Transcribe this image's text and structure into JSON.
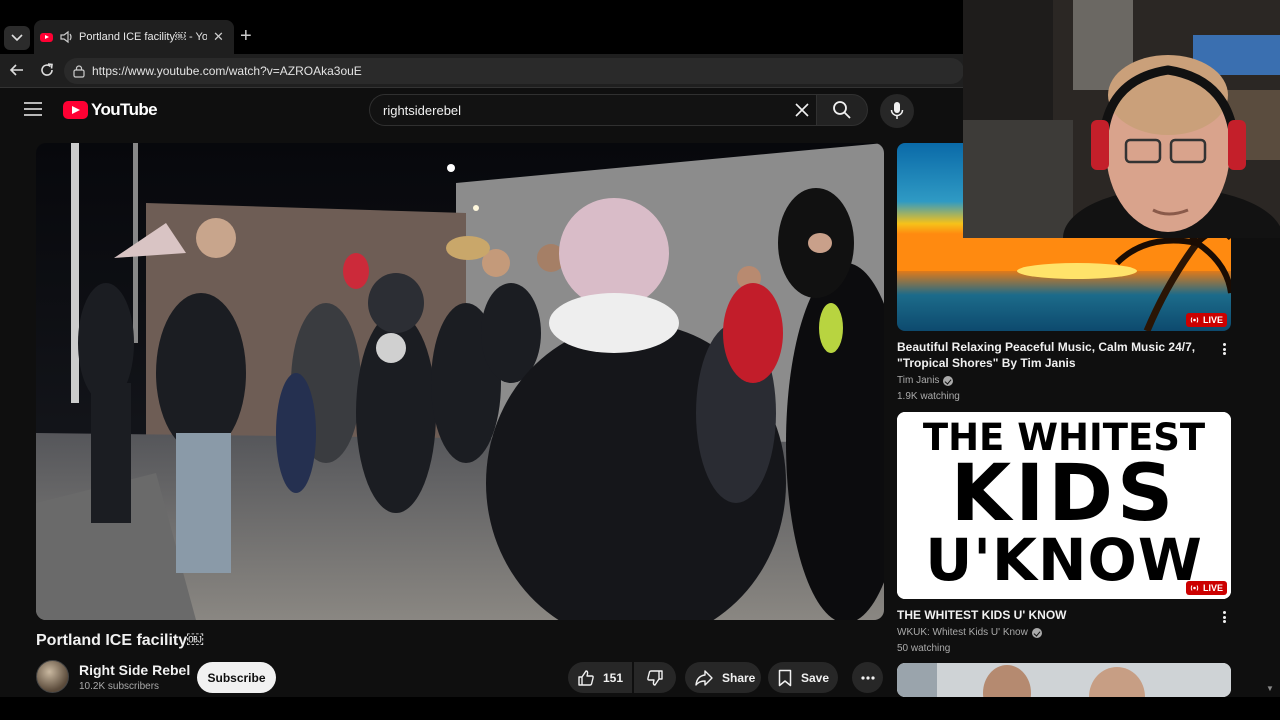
{
  "browser": {
    "tab_title": "Portland ICE facility￼ - YouTube",
    "tab_title_visible": "Portland ICE facility￼ - YouTu",
    "url": "https://www.youtube.com/watch?v=AZROAka3ouE"
  },
  "header": {
    "logo_text": "YouTube",
    "search_value": "rightsiderebel"
  },
  "video": {
    "title": "Portland ICE facility￼",
    "channel_name": "Right Side Rebel",
    "subscribers": "10.2K subscribers",
    "subscribe_label": "Subscribe",
    "like_count": "151",
    "share_label": "Share",
    "save_label": "Save"
  },
  "recommendations": [
    {
      "title_line1": "Beautiful Relaxing Peaceful Music, Calm Music 24/7,",
      "title_line2": "\"Tropical Shores\" By Tim Janis",
      "channel": "Tim Janis",
      "meta": "1.9K watching",
      "badge": "LIVE"
    },
    {
      "title_line1": "THE WHITEST KIDS U' KNOW",
      "channel": "WKUK: Whitest Kids U' Know",
      "meta": "50 watching",
      "badge": "LIVE",
      "thumb_text": [
        "THE WHITEST",
        "KIDS",
        "U'KNOW"
      ]
    }
  ],
  "colors": {
    "background": "#0f0f0f",
    "youtube_red": "#ff0033",
    "live_red": "#cc0000",
    "text_primary": "#f1f1f1",
    "text_secondary": "#aaaaaa"
  }
}
